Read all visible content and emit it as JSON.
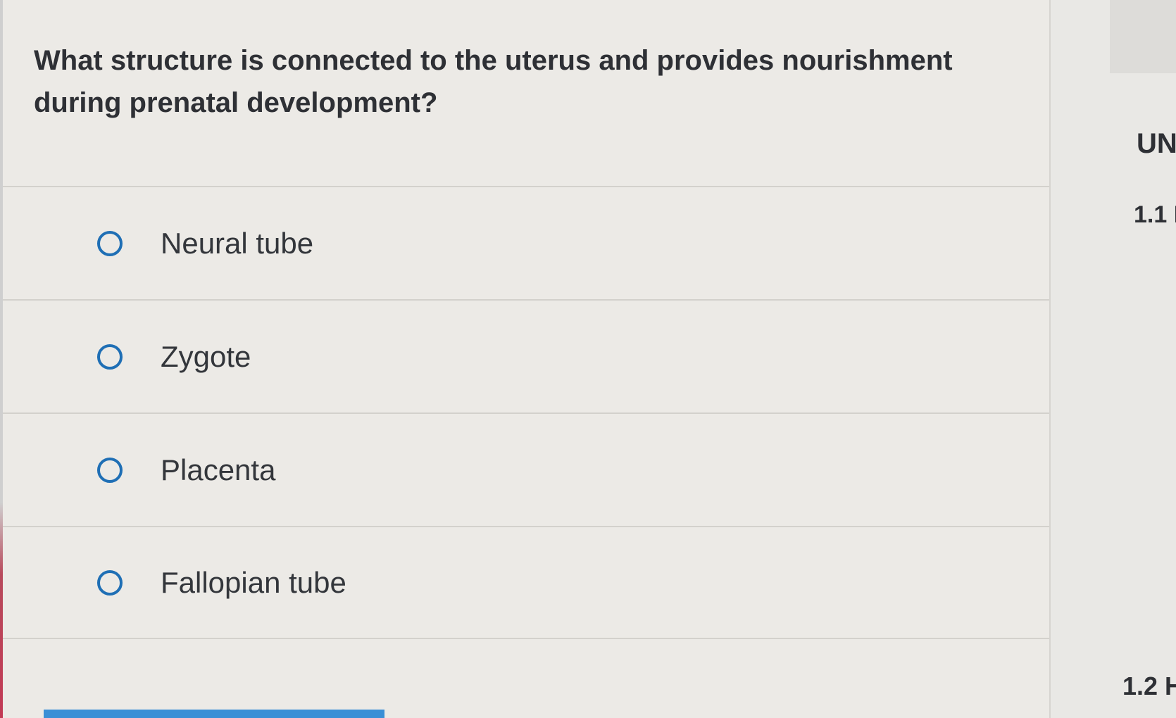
{
  "question": {
    "text": "What structure is connected to the uterus and provides nourishment during prenatal development?"
  },
  "options": [
    {
      "label": "Neural tube",
      "selected": false
    },
    {
      "label": "Zygote",
      "selected": false
    },
    {
      "label": "Placenta",
      "selected": false
    },
    {
      "label": "Fallopian tube",
      "selected": false
    }
  ],
  "sidebar": {
    "unit_heading": "UN",
    "lesson_1": "1.1 I",
    "lesson_2": "1.2 H"
  },
  "colors": {
    "radio_border": "#1f6fb5",
    "submit_bar": "#3a8fd6",
    "text": "#2e3035"
  }
}
